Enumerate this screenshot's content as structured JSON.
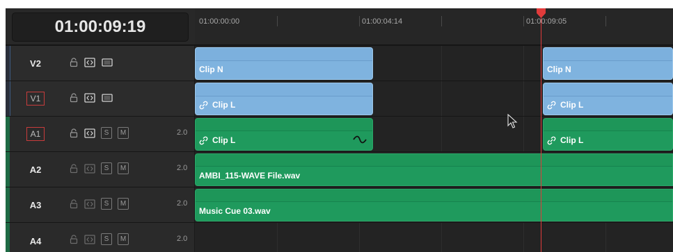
{
  "header": {
    "timecode": "01:00:09:19",
    "ruler_labels": [
      "01:00:00:00",
      "01:00:04:14",
      "01:00:09:05"
    ]
  },
  "tracks": [
    {
      "name": "V2",
      "type": "video",
      "patched": false
    },
    {
      "name": "V1",
      "type": "video",
      "patched": true
    },
    {
      "name": "A1",
      "type": "audio",
      "patched": true,
      "channels": "2.0"
    },
    {
      "name": "A2",
      "type": "audio",
      "patched": false,
      "channels": "2.0"
    },
    {
      "name": "A3",
      "type": "audio",
      "patched": false,
      "channels": "2.0"
    },
    {
      "name": "A4",
      "type": "audio",
      "patched": false,
      "channels": "2.0"
    }
  ],
  "buttons": {
    "solo": "S",
    "mute": "M"
  },
  "clips": {
    "v2_a": "Clip N",
    "v2_b": "Clip N",
    "v1_a": "Clip L",
    "v1_b": "Clip L",
    "a1_a": "Clip L",
    "a1_b": "Clip L",
    "a2": "AMBI_115-WAVE File.wav",
    "a3": "Music Cue 03.wav"
  },
  "colors": {
    "video_clip": "#7fb3df",
    "audio_clip": "#1f9a5d",
    "playhead": "#e13b3b",
    "patch_border": "#c83c3c"
  },
  "icons": [
    "lock-icon",
    "auto-select-icon",
    "track-enable-icon",
    "link-icon",
    "keyframe-curve-icon",
    "playhead-icon",
    "mouse-cursor-icon"
  ]
}
